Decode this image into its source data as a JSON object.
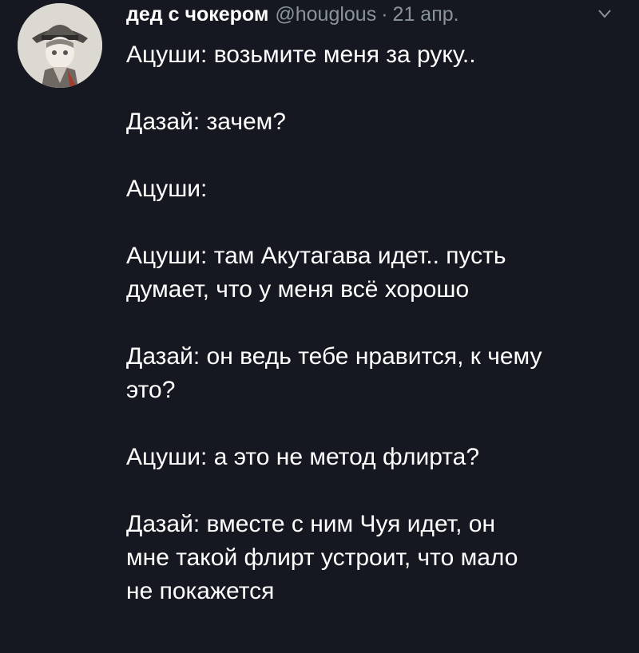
{
  "tweet": {
    "display_name": "дед с чокером",
    "handle": "@houglous",
    "separator": "·",
    "date": "21 апр.",
    "avatar_icon": "user-avatar-icon",
    "menu_icon": "chevron-down-icon",
    "colors": {
      "background": "#151820",
      "text": "#ffffff",
      "muted": "#8a939c"
    },
    "lines": [
      "Ацуши: возьмите меня за руку..",
      "",
      "Дазай: зачем?",
      "",
      "Ацуши:",
      "",
      "Ацуши: там Акутагава идет.. пусть",
      "думает, что у меня всё хорошо",
      "",
      "Дазай: он ведь тебе нравится, к чему",
      "это?",
      "",
      "Ацуши: а это не метод флирта?",
      "",
      "Дазай: вместе с ним Чуя идет, он",
      "мне такой флирт устроит, что мало",
      "не покажется"
    ]
  }
}
